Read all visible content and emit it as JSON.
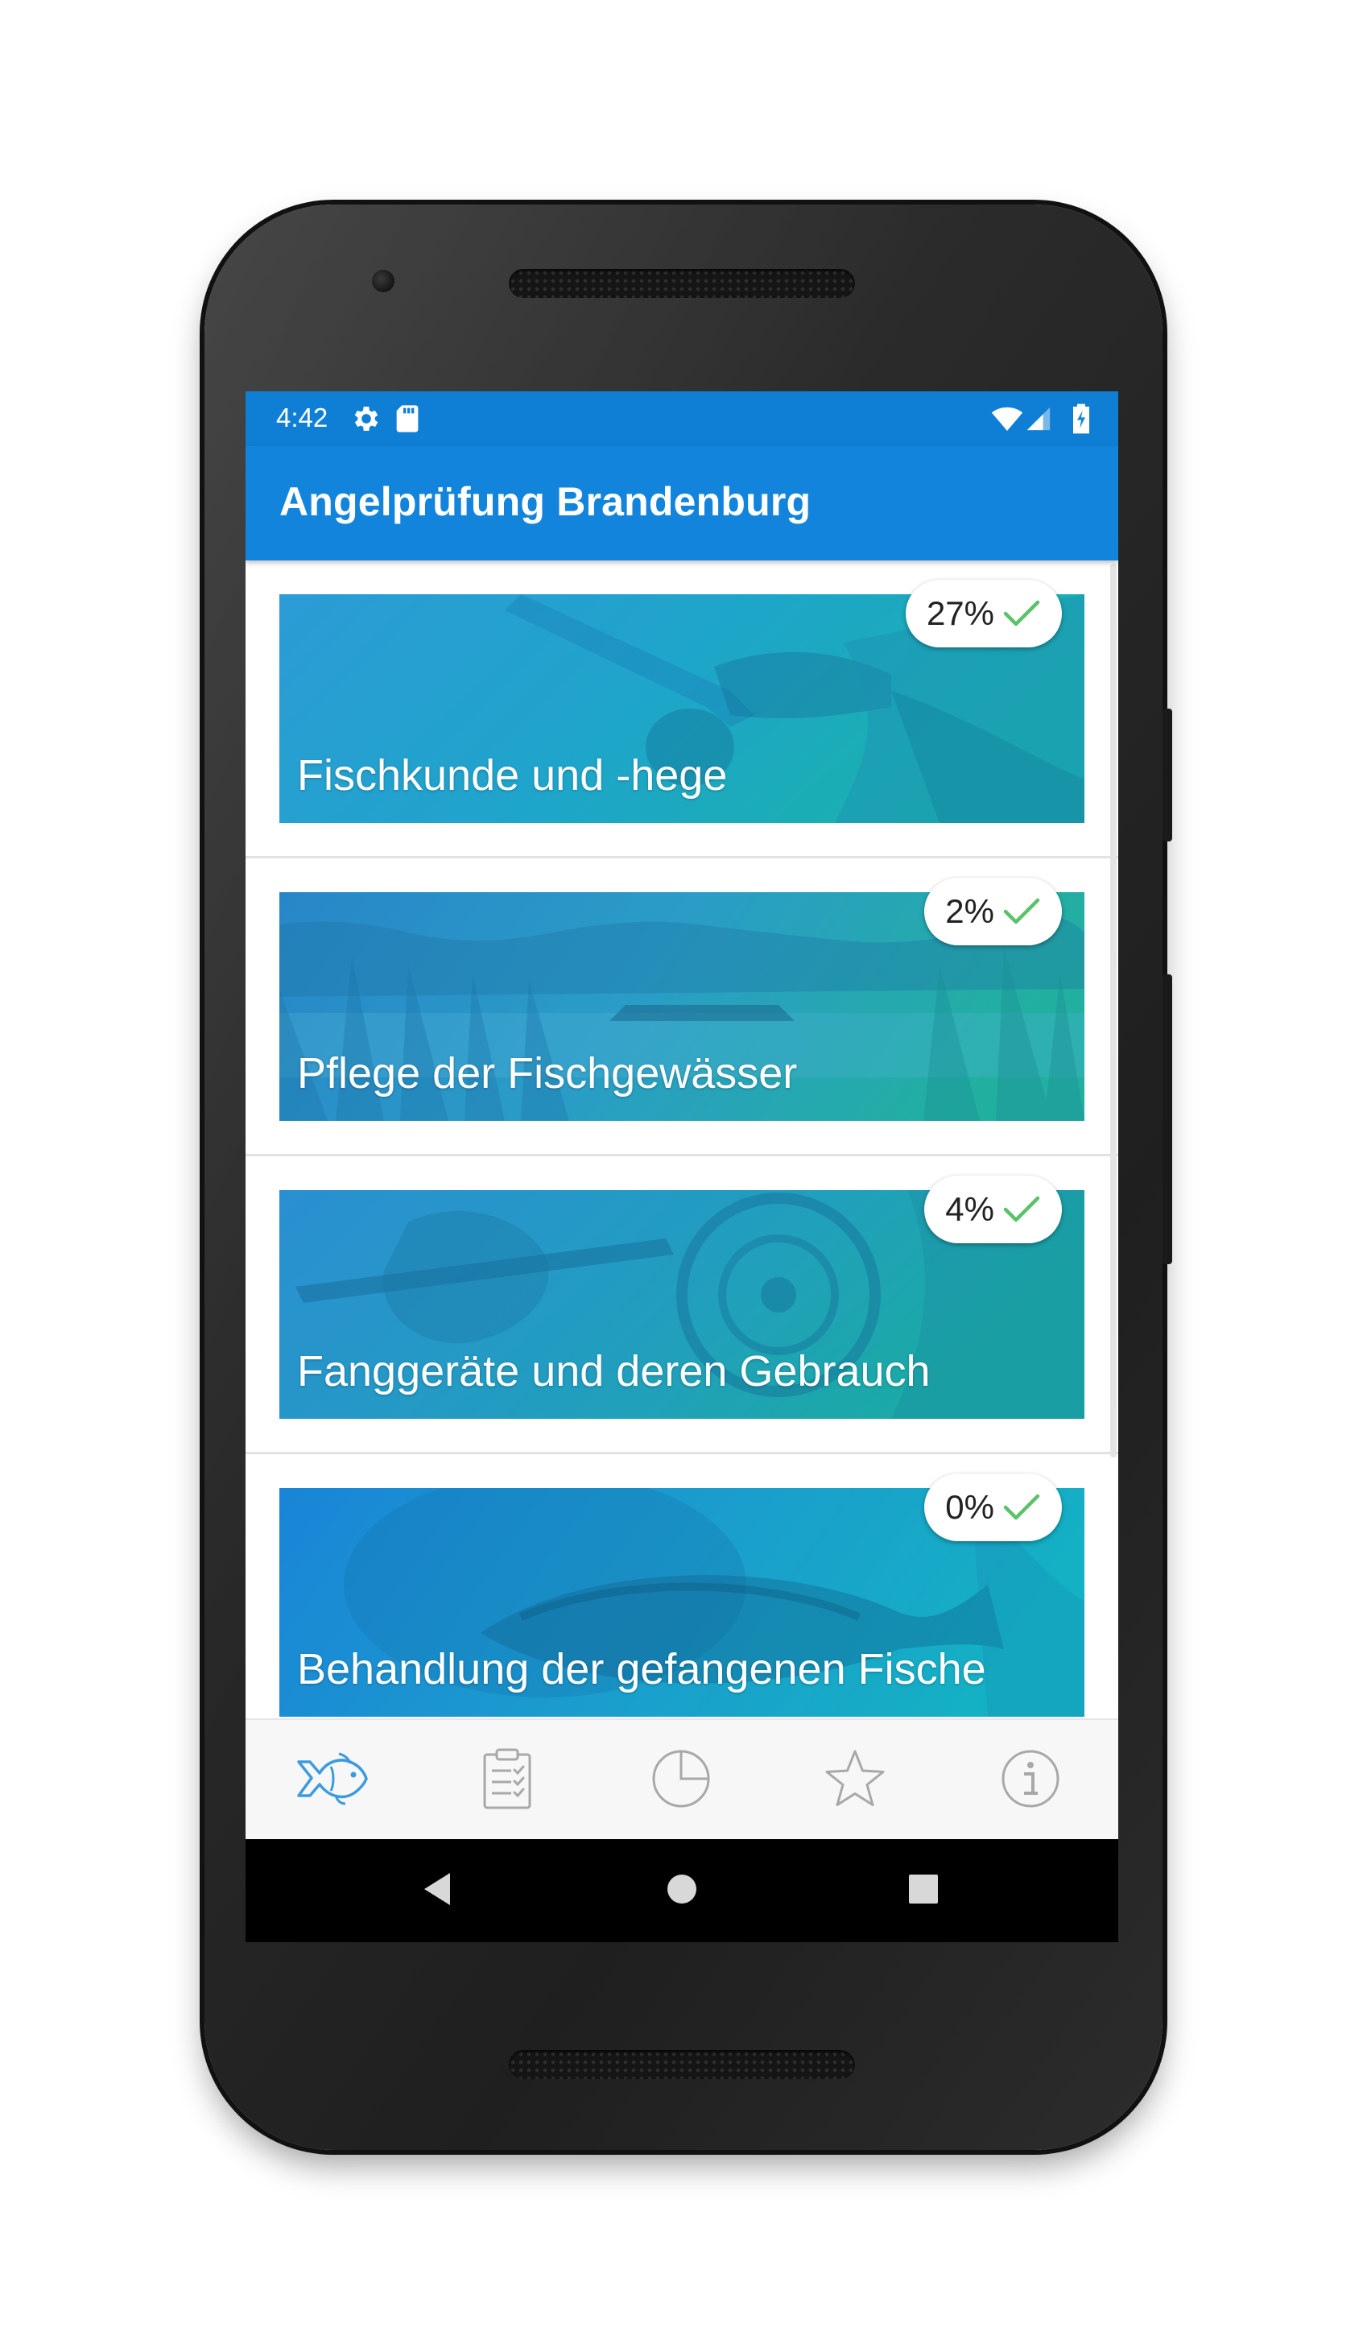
{
  "status_bar": {
    "time": "4:42",
    "icons": [
      "gear-icon",
      "sd-card-icon",
      "wifi-icon",
      "cell-signal-icon",
      "battery-charging-icon"
    ]
  },
  "app_bar": {
    "title": "Angelprüfung Brandenburg"
  },
  "categories": [
    {
      "title": "Fischkunde und -hege",
      "progress": "27%",
      "progress_value": 27
    },
    {
      "title": "Pflege der Fischgewässer",
      "progress": "2%",
      "progress_value": 2
    },
    {
      "title": "Fanggeräte und deren Gebrauch",
      "progress": "4%",
      "progress_value": 4
    },
    {
      "title": "Behandlung der gefangenen Fische",
      "progress": "0%",
      "progress_value": 0
    }
  ],
  "tabs": [
    {
      "icon": "fish-icon",
      "active": true
    },
    {
      "icon": "clipboard-checklist-icon",
      "active": false
    },
    {
      "icon": "pie-chart-icon",
      "active": false
    },
    {
      "icon": "star-icon",
      "active": false
    },
    {
      "icon": "info-icon",
      "active": false
    }
  ],
  "colors": {
    "primary": "#1384dc",
    "status_bar": "#0f7fd6",
    "check": "#5cc26a",
    "tab_active": "#3b9be0",
    "tab_inactive": "#a8a8a8"
  }
}
